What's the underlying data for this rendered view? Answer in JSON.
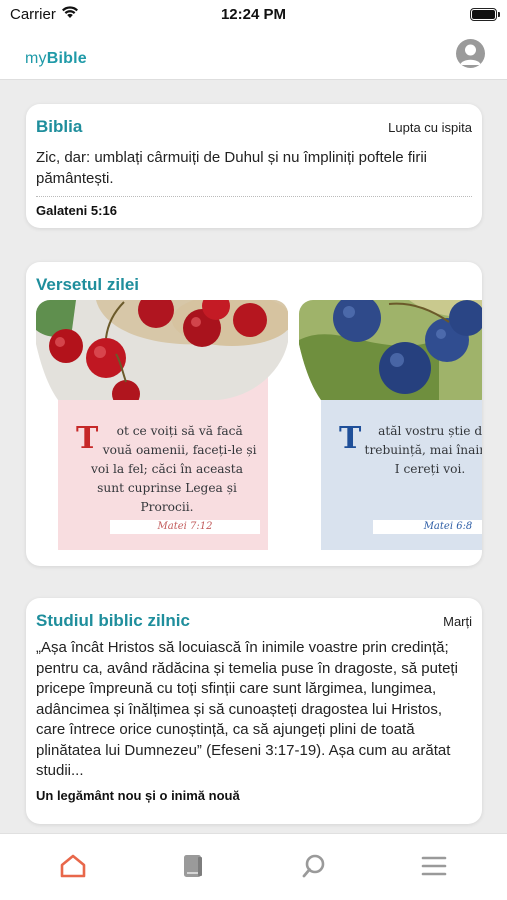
{
  "status_bar": {
    "carrier": "Carrier",
    "time": "12:24 PM"
  },
  "header": {
    "logo_prefix": "my",
    "logo_bold": "Bible"
  },
  "bible_card": {
    "title": "Biblia",
    "meta": "Lupta cu ispita",
    "text": "Zic, dar: umblați cârmuiți de Duhul și nu împliniți poftele firii pământești.",
    "reference": "Galateni 5:16"
  },
  "verse_card": {
    "title": "Versetul zilei",
    "slides": [
      {
        "drop": "T",
        "quote": "ot ce voiți să vă facă vouă oamenii, faceți-le și voi la fel; căci în aceasta sunt cuprinse Legea și Prorocii.",
        "reference": "Matei 7:12"
      },
      {
        "drop": "T",
        "quote": "atăl vostru știe de ce trebuință, mai înainte să-I cereți voi.",
        "reference": "Matei 6:8"
      }
    ]
  },
  "study_card": {
    "title": "Studiul biblic zilnic",
    "meta": "Marți",
    "text": "„Așa încât Hristos să locuiască în inimile voastre prin credință; pentru ca, având rădăcina și temelia puse în dragoste, să puteți pricepe împreună cu toți sfinții care sunt lărgimea, lungimea, adâncimea și înălțimea și să cunoașteți dragostea lui Hristos, care întrece orice cunoștință, ca să ajungeți plini de toată plinătatea lui Dumnezeu” (Efeseni 3:17-19). Așa cum au arătat studii...",
    "reference": "Un legământ nou și o inimă nouă"
  },
  "tab_bar": {
    "tabs": [
      {
        "icon": "home-icon",
        "active": true
      },
      {
        "icon": "book-icon",
        "active": false
      },
      {
        "icon": "search-icon",
        "active": false
      },
      {
        "icon": "menu-icon",
        "active": false
      }
    ]
  },
  "colors": {
    "accent": "#1f8e9c",
    "active_tab": "#e8674a",
    "inactive_tab": "#9a9a9a"
  }
}
